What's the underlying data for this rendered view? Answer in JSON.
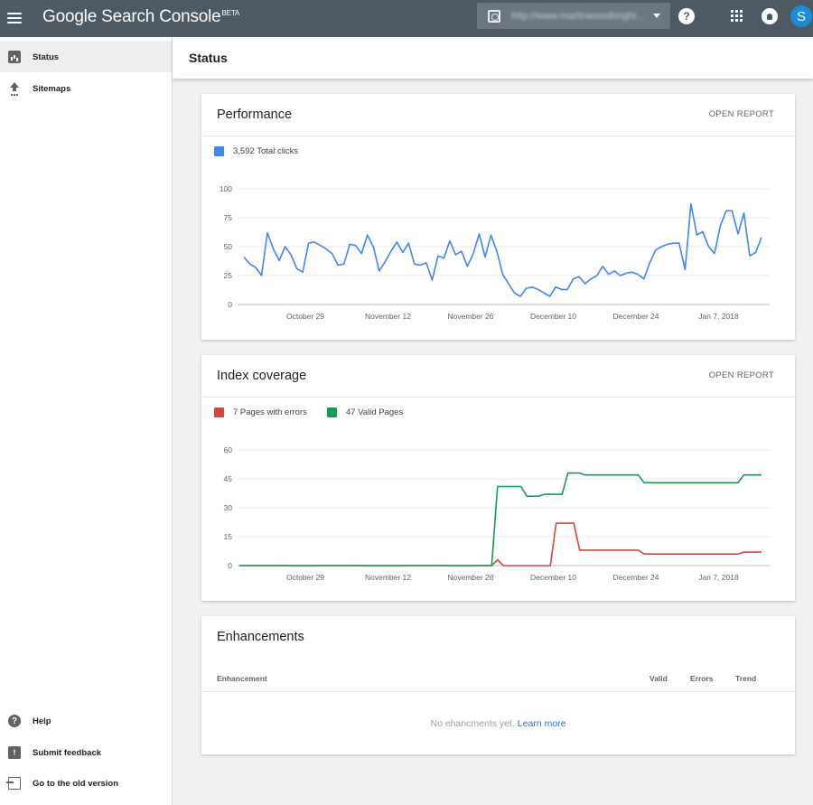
{
  "app": {
    "title": "Google Search Console",
    "badge": "BETA",
    "property_url": "http://www.martinwoodbright...",
    "avatar_letter": "S",
    "help_glyph": "?"
  },
  "colors": {
    "topbar": "#4d5a63",
    "clicks": "#4285f4",
    "errors": "#db4437",
    "valid": "#0f9d58",
    "link": "#1a73e8"
  },
  "sidebar": {
    "items": [
      {
        "label": "Status",
        "icon": "status-icon",
        "active": true
      },
      {
        "label": "Sitemaps",
        "icon": "upload-icon",
        "active": false
      }
    ],
    "footer": [
      {
        "label": "Help",
        "icon": "help-icon"
      },
      {
        "label": "Submit feedback",
        "icon": "feedback-icon"
      },
      {
        "label": "Go to the old version",
        "icon": "exit-icon"
      }
    ]
  },
  "page": {
    "title": "Status"
  },
  "performance": {
    "title": "Performance",
    "open_report": "OPEN REPORT",
    "legend": "3,592 Total clicks"
  },
  "coverage": {
    "title": "Index coverage",
    "open_report": "OPEN REPORT",
    "legend_errors": "7 Pages with errors",
    "legend_valid": "47 Valid Pages"
  },
  "enhancements": {
    "title": "Enhancements",
    "columns": [
      "Enhancement",
      "Valid",
      "Errors",
      "Trend"
    ],
    "empty_text": "No ehancments yet.",
    "learn_more": "Learn more"
  },
  "chart_data": [
    {
      "type": "line",
      "x_ticks": [
        "October 29",
        "November 12",
        "November 26",
        "December 10",
        "December 24",
        "Jan 7, 2018"
      ],
      "y_ticks": [
        0,
        25,
        50,
        75,
        100
      ],
      "ylim": [
        0,
        100
      ],
      "grid": true,
      "series": [
        {
          "name": "Total clicks",
          "color": "#4285f4",
          "values": [
            41,
            35,
            32,
            25,
            62,
            48,
            38,
            50,
            43,
            31,
            28,
            53,
            54,
            51,
            48,
            44,
            34,
            35,
            52,
            51,
            44,
            60,
            50,
            29,
            37,
            46,
            54,
            45,
            53,
            35,
            34,
            36,
            21,
            42,
            40,
            55,
            43,
            46,
            33,
            44,
            61,
            41,
            60,
            46,
            26,
            18,
            10,
            7,
            14,
            15,
            13,
            10,
            7,
            15,
            13,
            13,
            22,
            24,
            18,
            22,
            25,
            33,
            26,
            29,
            25,
            27,
            28,
            26,
            22,
            36,
            47,
            50,
            52,
            53,
            53,
            30,
            87,
            60,
            63,
            50,
            44,
            68,
            81,
            81,
            61,
            79,
            42,
            45,
            58
          ]
        }
      ]
    },
    {
      "type": "line",
      "x_ticks": [
        "October 29",
        "November 12",
        "November 26",
        "December 10",
        "December 24",
        "Jan 7, 2018"
      ],
      "y_ticks": [
        0,
        15,
        30,
        45,
        60
      ],
      "ylim": [
        0,
        60
      ],
      "grid": true,
      "series": [
        {
          "name": "Pages with errors",
          "color": "#db4437",
          "values": [
            0,
            0,
            0,
            0,
            0,
            0,
            0,
            0,
            0,
            0,
            0,
            0,
            0,
            0,
            0,
            0,
            0,
            0,
            0,
            0,
            0,
            0,
            0,
            0,
            0,
            0,
            0,
            0,
            0,
            0,
            0,
            0,
            0,
            0,
            0,
            0,
            0,
            0,
            0,
            0,
            0,
            0,
            0,
            0,
            3,
            0,
            0,
            0,
            0,
            0,
            0,
            0,
            0,
            0,
            22,
            22,
            22,
            22,
            8,
            8,
            8,
            8,
            8,
            8,
            8,
            8,
            8,
            8,
            8,
            6,
            6,
            6,
            6,
            6,
            6,
            6,
            6,
            6,
            6,
            6,
            6,
            6,
            6,
            6,
            6,
            6,
            7,
            7,
            7,
            7
          ]
        },
        {
          "name": "Valid Pages",
          "color": "#0f9d58",
          "values": [
            0,
            0,
            0,
            0,
            0,
            0,
            0,
            0,
            0,
            0,
            0,
            0,
            0,
            0,
            0,
            0,
            0,
            0,
            0,
            0,
            0,
            0,
            0,
            0,
            0,
            0,
            0,
            0,
            0,
            0,
            0,
            0,
            0,
            0,
            0,
            0,
            0,
            0,
            0,
            0,
            0,
            0,
            0,
            0,
            41,
            41,
            41,
            41,
            41,
            36,
            36,
            36,
            37,
            37,
            37,
            37,
            48,
            48,
            48,
            47,
            47,
            47,
            47,
            47,
            47,
            47,
            47,
            47,
            47,
            43,
            43,
            43,
            43,
            43,
            43,
            43,
            43,
            43,
            43,
            43,
            43,
            43,
            43,
            43,
            43,
            43,
            47,
            47,
            47,
            47
          ]
        }
      ]
    }
  ]
}
